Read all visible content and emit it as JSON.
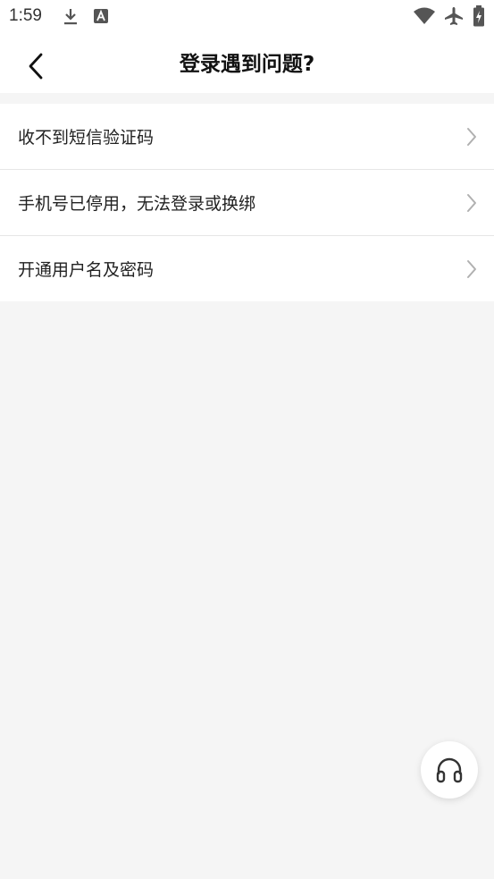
{
  "status_bar": {
    "time": "1:59",
    "icons": [
      "download-icon",
      "app-notification-icon",
      "wifi-icon",
      "airplane-icon",
      "battery-icon"
    ]
  },
  "header": {
    "title": "登录遇到问题?",
    "back_icon": "chevron-left-icon"
  },
  "list": {
    "items": [
      {
        "label": "收不到短信验证码",
        "icon": "chevron-right-icon"
      },
      {
        "label": "手机号已停用，无法登录或换绑",
        "icon": "chevron-right-icon"
      },
      {
        "label": "开通用户名及密码",
        "icon": "chevron-right-icon"
      }
    ]
  },
  "support_button": {
    "icon": "headphones-icon"
  },
  "colors": {
    "background": "#f5f5f5",
    "surface": "#ffffff",
    "text": "#222222",
    "chevron": "#b0b0b0"
  }
}
